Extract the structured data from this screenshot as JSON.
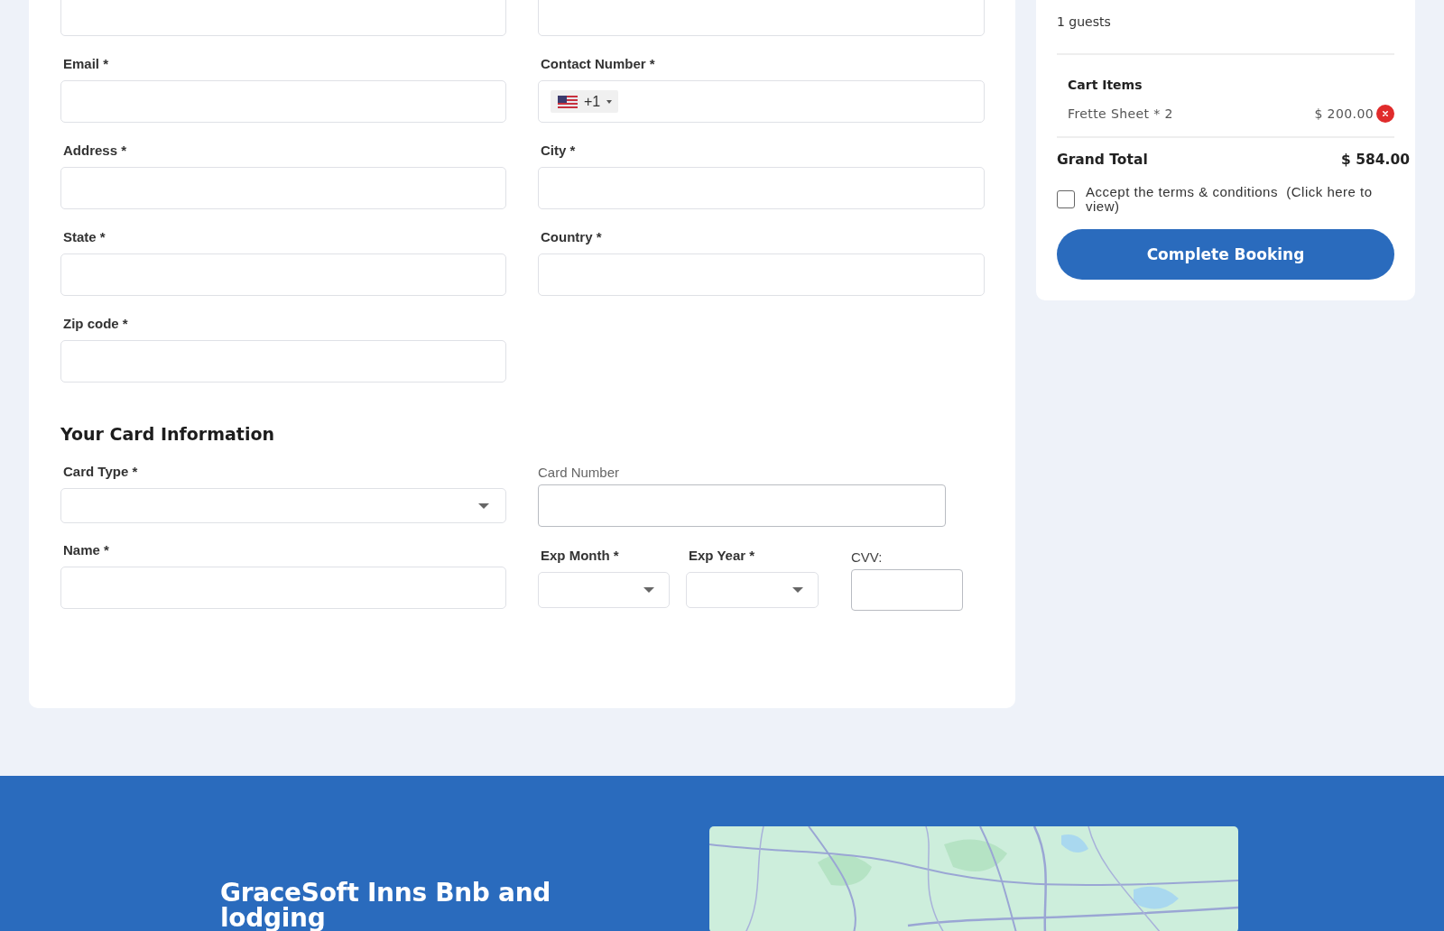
{
  "billing_fields": [
    {
      "kind": "text"
    },
    {
      "kind": "text"
    },
    {
      "kind": "text",
      "label": "Email *"
    },
    {
      "kind": "phone",
      "label": "Contact Number *",
      "dial_code": "+1"
    },
    {
      "kind": "text",
      "label": "Address *"
    },
    {
      "kind": "text",
      "label": "City *"
    },
    {
      "kind": "text",
      "label": "State *"
    },
    {
      "kind": "text",
      "label": "Country *"
    },
    {
      "kind": "text",
      "label": "Zip code *"
    }
  ],
  "card_information": {
    "title": "Your Card Information",
    "card_type": {
      "label": "Card Type *"
    },
    "card_number": {
      "label": "Card Number"
    },
    "name": {
      "label": "Name *"
    },
    "exp_month": {
      "label": "Exp Month *"
    },
    "exp_year": {
      "label": "Exp Year *"
    },
    "cvv": {
      "label": "CVV:"
    }
  },
  "booking_summary": {
    "guests": "1 guests",
    "cart_title": "Cart Items",
    "cart_items": [
      {
        "name": "Frette Sheet * 2",
        "price": "$ 200.00"
      }
    ],
    "grand_total": {
      "label": "Grand Total",
      "value": "$ 584.00"
    },
    "terms": {
      "label": "Accept the terms & conditions  (Click here to view)",
      "checked": false
    },
    "button": "Complete Booking"
  },
  "footer": {
    "title": "GraceSoft Inns Bnb and lodging"
  }
}
